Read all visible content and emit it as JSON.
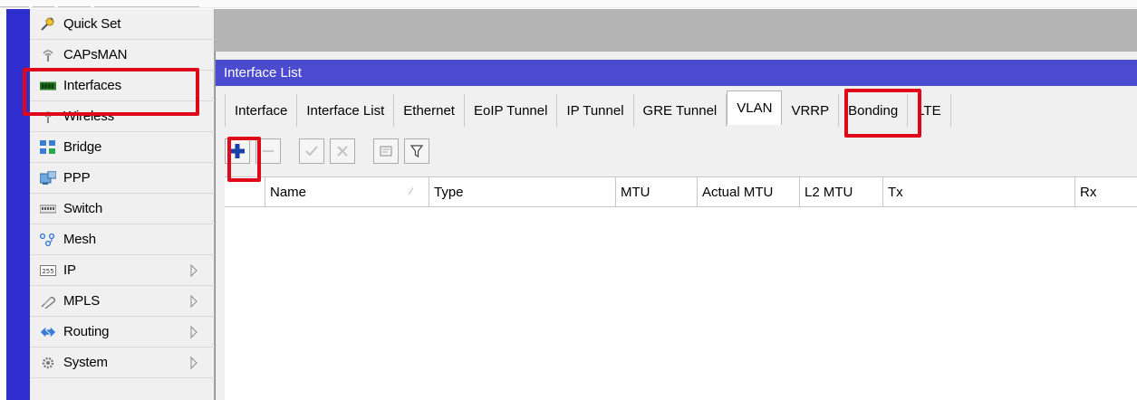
{
  "sidebar": {
    "items": [
      {
        "label": "Quick Set",
        "icon": "quick-set-icon"
      },
      {
        "label": "CAPsMAN",
        "icon": "capsman-icon"
      },
      {
        "label": "Interfaces",
        "icon": "interfaces-icon"
      },
      {
        "label": "Wireless",
        "icon": "wireless-icon"
      },
      {
        "label": "Bridge",
        "icon": "bridge-icon"
      },
      {
        "label": "PPP",
        "icon": "ppp-icon"
      },
      {
        "label": "Switch",
        "icon": "switch-icon"
      },
      {
        "label": "Mesh",
        "icon": "mesh-icon"
      },
      {
        "label": "IP",
        "icon": "ip-icon",
        "submenu": true
      },
      {
        "label": "MPLS",
        "icon": "mpls-icon",
        "submenu": true
      },
      {
        "label": "Routing",
        "icon": "routing-icon",
        "submenu": true
      },
      {
        "label": "System",
        "icon": "system-icon",
        "submenu": true
      }
    ]
  },
  "window": {
    "title": "Interface List",
    "tabs": [
      "Interface",
      "Interface List",
      "Ethernet",
      "EoIP Tunnel",
      "IP Tunnel",
      "GRE Tunnel",
      "VLAN",
      "VRRP",
      "Bonding",
      "LTE"
    ],
    "active_tab": "VLAN",
    "toolbar": [
      "add-icon",
      "remove-icon",
      "enable-icon",
      "disable-icon",
      "comment-icon",
      "filter-icon"
    ],
    "columns": [
      "Name",
      "Type",
      "MTU",
      "Actual MTU",
      "L2 MTU",
      "Tx",
      "Rx"
    ]
  },
  "colors": {
    "left_band": "#2f2fcf",
    "title_bar": "#4b4bd0",
    "highlight": "#e0071b",
    "add_plus": "#1b3fa8"
  }
}
